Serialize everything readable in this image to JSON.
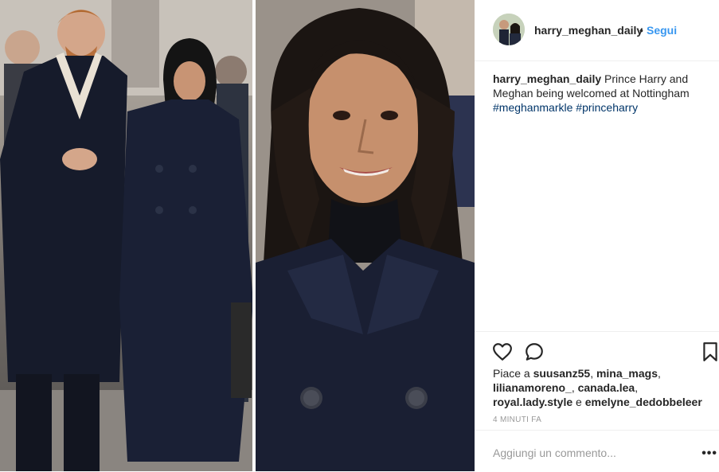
{
  "post": {
    "username": "harry_meghan_daily",
    "separator": "•",
    "follow_label": "Segui",
    "caption": {
      "username": "harry_meghan_daily",
      "text": " Prince Harry and Meghan being welcomed at Nottingham ",
      "hashtags": [
        "#meghanmarkle",
        "#princeharry"
      ]
    },
    "likes": {
      "prefix": "Piace a ",
      "users": [
        "suusanz55",
        "mina_mags",
        "lilianamoreno_",
        "canada.lea",
        "royal.lady.style",
        "emelyne_dedobbeleer"
      ],
      "conjunction": " e "
    },
    "timestamp": "4 MINUTI FA",
    "comment_placeholder": "Aggiungi un commento...",
    "more_label": "•••"
  },
  "icons": {
    "like": "heart-icon",
    "comment": "comment-icon",
    "save": "bookmark-icon",
    "more": "more-options-icon"
  },
  "colors": {
    "link_blue": "#3897f0",
    "hashtag": "#003569",
    "text": "#262626",
    "muted": "#999999",
    "border": "#efefef"
  }
}
